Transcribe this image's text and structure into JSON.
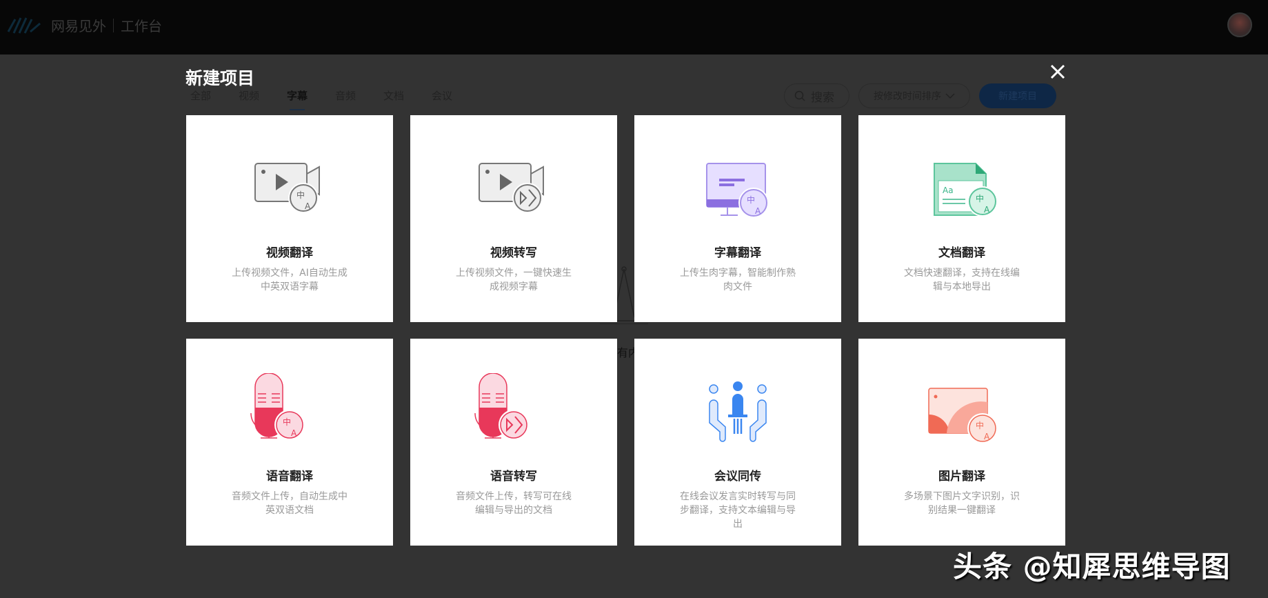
{
  "topbar": {
    "brand": "网易见外",
    "section": "工作台"
  },
  "modal": {
    "title": "新建项目"
  },
  "tabs": [
    {
      "label": "全部"
    },
    {
      "label": "视频"
    },
    {
      "label": "字幕"
    },
    {
      "label": "音频"
    },
    {
      "label": "文档"
    },
    {
      "label": "会议"
    }
  ],
  "active_tab": "字幕",
  "toolbar": {
    "search_placeholder": "搜索",
    "sort_label": "按修改时间排序",
    "new_button": "新建项目"
  },
  "background": {
    "empty_text": "有内"
  },
  "cards": [
    {
      "title": "视频翻译",
      "desc": "上传视频文件，AI自动生成中英双语字幕",
      "icon": "video-translate-icon",
      "color": "#888888"
    },
    {
      "title": "视频转写",
      "desc": "上传视频文件，一键快速生成视频字幕",
      "icon": "video-transcribe-icon",
      "color": "#888888"
    },
    {
      "title": "字幕翻译",
      "desc": "上传生肉字幕，智能制作熟肉文件",
      "icon": "subtitle-translate-icon",
      "color": "#8b6fe0"
    },
    {
      "title": "文档翻译",
      "desc": "文档快速翻译，支持在线编辑与本地导出",
      "icon": "document-translate-icon",
      "color": "#3bb58a"
    },
    {
      "title": "语音翻译",
      "desc": "音频文件上传，自动生成中英双语文档",
      "icon": "audio-translate-icon",
      "color": "#e8385a"
    },
    {
      "title": "语音转写",
      "desc": "音频文件上传，转写可在线编辑与导出的文档",
      "icon": "audio-transcribe-icon",
      "color": "#e8385a"
    },
    {
      "title": "会议同传",
      "desc": "在线会议发言实时转写与同步翻译，支持文本编辑与导出",
      "icon": "meeting-icon",
      "color": "#3a86f0"
    },
    {
      "title": "图片翻译",
      "desc": "多场景下图片文字识别，识别结果一键翻译",
      "icon": "image-translate-icon",
      "color": "#f06a55"
    }
  ],
  "watermark": "头条 @知犀思维导图"
}
